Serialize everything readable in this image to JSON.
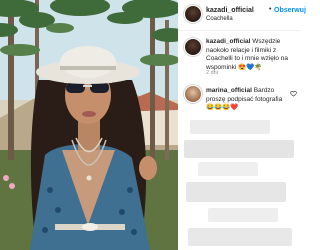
{
  "post": {
    "owner": "kazadi_official",
    "location": "Coachella",
    "separator": "•",
    "follow_label": "Obserwuj"
  },
  "comments": [
    {
      "username": "kazadi_official",
      "text": "Wszędzie naokoło relacje i filmiki z Coachelli to i mnie wzięło na wspominki 😍💙🌴",
      "time": "2 dni"
    },
    {
      "username": "marina_official",
      "text": "Bardzo proszę podpisać fotografia 😂😂😂❤️"
    }
  ],
  "colors": {
    "accent": "#0095f6",
    "text": "#262626",
    "muted": "#8e8e8e",
    "divider": "#efefef"
  }
}
